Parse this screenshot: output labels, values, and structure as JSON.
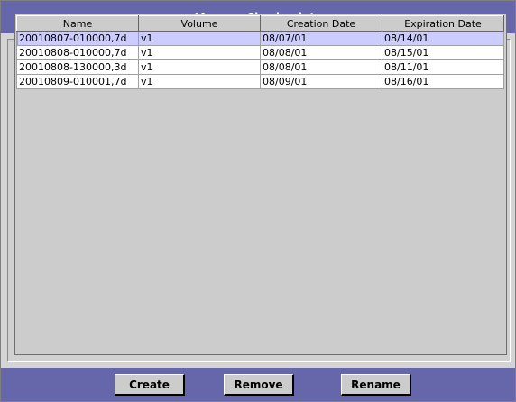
{
  "window": {
    "title": "Manage Checkpoints"
  },
  "table": {
    "columns": [
      "Name",
      "Volume",
      "Creation Date",
      "Expiration Date"
    ],
    "rows": [
      {
        "name": "20010807-010000,7d",
        "volume": "v1",
        "creation": "08/07/01",
        "expiration": "08/14/01",
        "selected": true
      },
      {
        "name": "20010808-010000,7d",
        "volume": "v1",
        "creation": "08/08/01",
        "expiration": "08/15/01",
        "selected": false
      },
      {
        "name": "20010808-130000,3d",
        "volume": "v1",
        "creation": "08/08/01",
        "expiration": "08/11/01",
        "selected": false
      },
      {
        "name": "20010809-010001,7d",
        "volume": "v1",
        "creation": "08/09/01",
        "expiration": "08/16/01",
        "selected": false
      }
    ]
  },
  "buttons": {
    "create": "Create",
    "remove": "Remove",
    "rename": "Rename"
  },
  "colors": {
    "titlebar": "#6666aa",
    "selection": "#ccccff",
    "panel": "#cccccc"
  }
}
